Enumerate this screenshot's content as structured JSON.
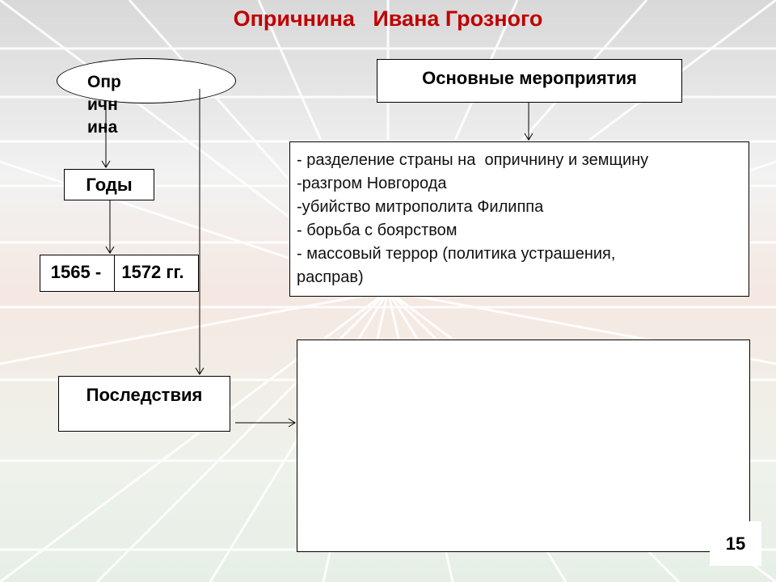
{
  "title": "Опричнина   Ивана Грозного",
  "nodes": {
    "oprichnina": "Опричнина",
    "years": "Годы",
    "year_start": "1565 -",
    "year_end": "1572 гг.",
    "main_events": "Основные мероприятия",
    "consequences": "Последствия"
  },
  "events": [
    "- разделение страны на  опричнину и земщину",
    "-разгром Новгорода",
    "-убийство митрополита Филиппа",
    "- борьба с боярством",
    "- массовый террор (политика устрашения,",
    "расправ)"
  ],
  "consequences_text": "",
  "slide_number": "15",
  "colors": {
    "title": "#c00000",
    "box_fill": "#ffffff",
    "border": "#000000"
  }
}
